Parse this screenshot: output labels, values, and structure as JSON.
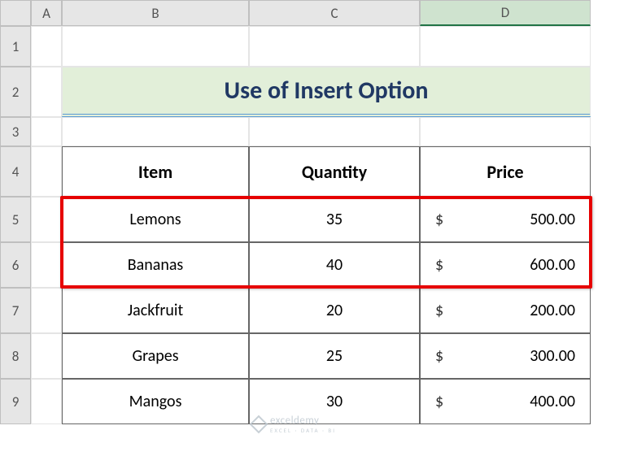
{
  "columns": [
    "A",
    "B",
    "C",
    "D"
  ],
  "rows": [
    "1",
    "2",
    "3",
    "4",
    "5",
    "6",
    "7",
    "8",
    "9"
  ],
  "selected_col": "D",
  "title": "Use of Insert Option",
  "table": {
    "headers": [
      "Item",
      "Quantity",
      "Price"
    ],
    "rows": [
      {
        "item": "Lemons",
        "qty": "35",
        "currency": "$",
        "price": "500.00"
      },
      {
        "item": "Bananas",
        "qty": "40",
        "currency": "$",
        "price": "600.00"
      },
      {
        "item": "Jackfruit",
        "qty": "20",
        "currency": "$",
        "price": "200.00"
      },
      {
        "item": "Grapes",
        "qty": "25",
        "currency": "$",
        "price": "300.00"
      },
      {
        "item": "Mangos",
        "qty": "30",
        "currency": "$",
        "price": "400.00"
      }
    ]
  },
  "watermark": {
    "brand": "exceldemy",
    "tagline": "EXCEL · DATA · BI"
  }
}
